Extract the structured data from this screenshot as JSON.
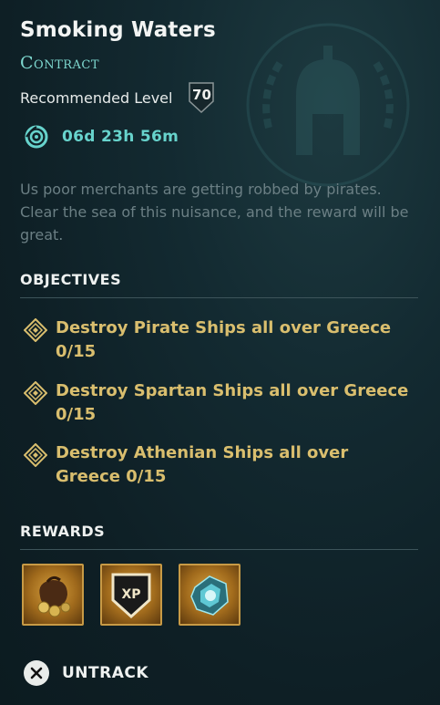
{
  "quest": {
    "title": "Smoking Waters",
    "type": "Contract",
    "recommended_label": "Recommended Level",
    "recommended_level": "70",
    "timer": "06d 23h 56m",
    "description": "Us poor merchants are getting robbed by pirates. Clear the sea of this nuisance, and the reward will be great."
  },
  "objectives": {
    "header": "OBJECTIVES",
    "items": [
      {
        "text": "Destroy Pirate Ships all over Greece 0/15"
      },
      {
        "text": "Destroy Spartan Ships all over Greece 0/15"
      },
      {
        "text": "Destroy Athenian Ships all over Greece 0/15"
      }
    ]
  },
  "rewards": {
    "header": "REWARDS",
    "items": [
      {
        "icon": "drachmae-pouch-icon"
      },
      {
        "icon": "xp-shield-icon",
        "label": "XP"
      },
      {
        "icon": "crafting-material-icon"
      }
    ]
  },
  "actions": {
    "untrack_label": "UNTRACK",
    "untrack_icon": "close-icon"
  },
  "colors": {
    "accent_teal": "#67d3cc",
    "objective_gold": "#d9be6e",
    "reward_border": "#c89a45"
  }
}
